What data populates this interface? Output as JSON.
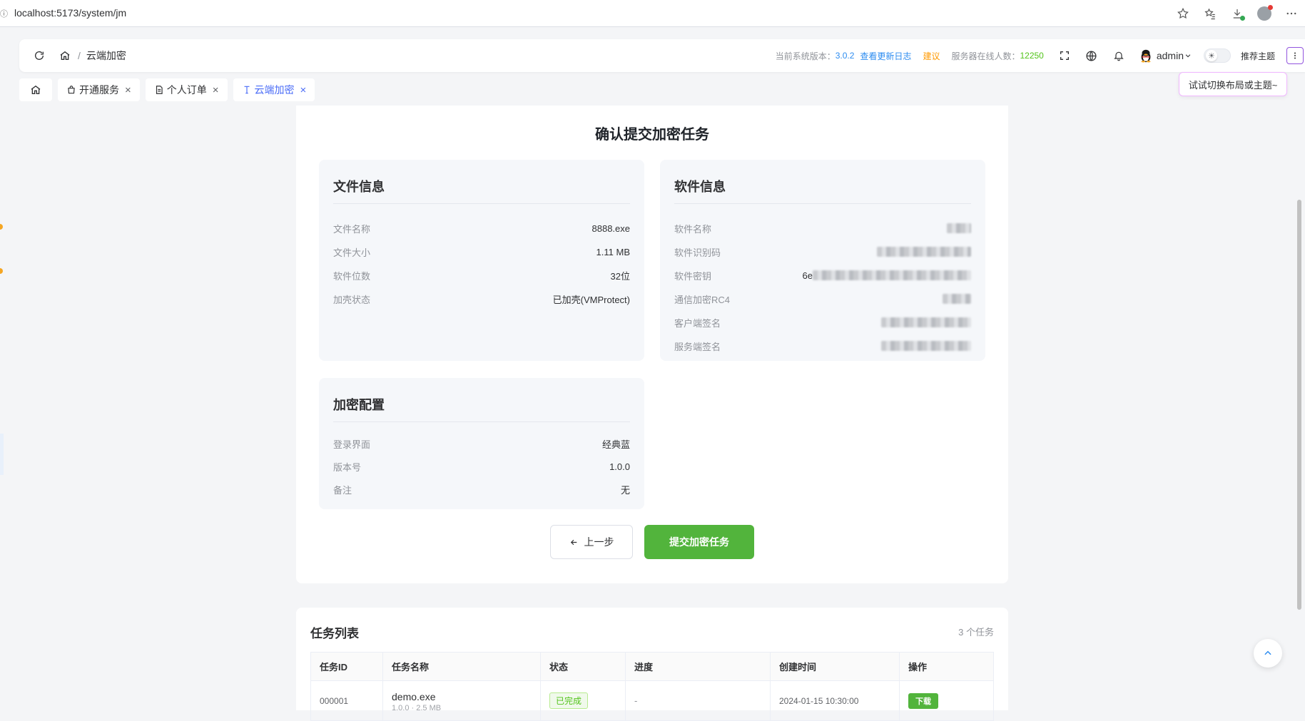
{
  "browser": {
    "url": "localhost:5173/system/jm"
  },
  "header": {
    "breadcrumb": "云端加密",
    "version_label": "当前系统版本：",
    "version": "3.0.2",
    "changelog_link": "查看更新日志",
    "suggest_link": "建议",
    "online_label": "服务器在线人数：",
    "online_count": "12250",
    "user": "admin",
    "theme_button": "推荐主题",
    "tooltip": "试试切换布局或主题~"
  },
  "tabs": [
    {
      "label": "开通服务"
    },
    {
      "label": "个人订单"
    },
    {
      "label": "云端加密"
    }
  ],
  "confirm": {
    "title": "确认提交加密任务",
    "file_info": {
      "title": "文件信息",
      "rows": [
        {
          "key": "文件名称",
          "value": "8888.exe"
        },
        {
          "key": "文件大小",
          "value": "1.11 MB"
        },
        {
          "key": "软件位数",
          "value": "32位"
        },
        {
          "key": "加壳状态",
          "value": "已加壳(VMProtect)"
        }
      ]
    },
    "software_info": {
      "title": "软件信息",
      "rows": [
        {
          "key": "软件名称",
          "value": ""
        },
        {
          "key": "软件识别码",
          "value": ""
        },
        {
          "key": "软件密钥",
          "value": "6e"
        },
        {
          "key": "通信加密RC4",
          "value": ""
        },
        {
          "key": "客户端签名",
          "value": ""
        },
        {
          "key": "服务端签名",
          "value": ""
        }
      ]
    },
    "encrypt_config": {
      "title": "加密配置",
      "rows": [
        {
          "key": "登录界面",
          "value": "经典蓝"
        },
        {
          "key": "版本号",
          "value": "1.0.0"
        },
        {
          "key": "备注",
          "value": "无"
        }
      ]
    },
    "prev_button": "上一步",
    "submit_button": "提交加密任务"
  },
  "task_list": {
    "title": "任务列表",
    "count": "3 个任务",
    "columns": [
      "任务ID",
      "任务名称",
      "状态",
      "进度",
      "创建时间",
      "操作"
    ],
    "rows": [
      {
        "id": "000001",
        "name": "demo.exe",
        "sub": "1.0.0 · 2.5 MB",
        "status": "已完成",
        "progress": "-",
        "created": "2024-01-15 10:30:00",
        "action": "下载"
      }
    ]
  },
  "colors": {
    "accent_blue": "#2d8cf0",
    "primary_green": "#52b43c",
    "tab_active": "#4a6cf7",
    "warning_orange": "#ff9900"
  }
}
